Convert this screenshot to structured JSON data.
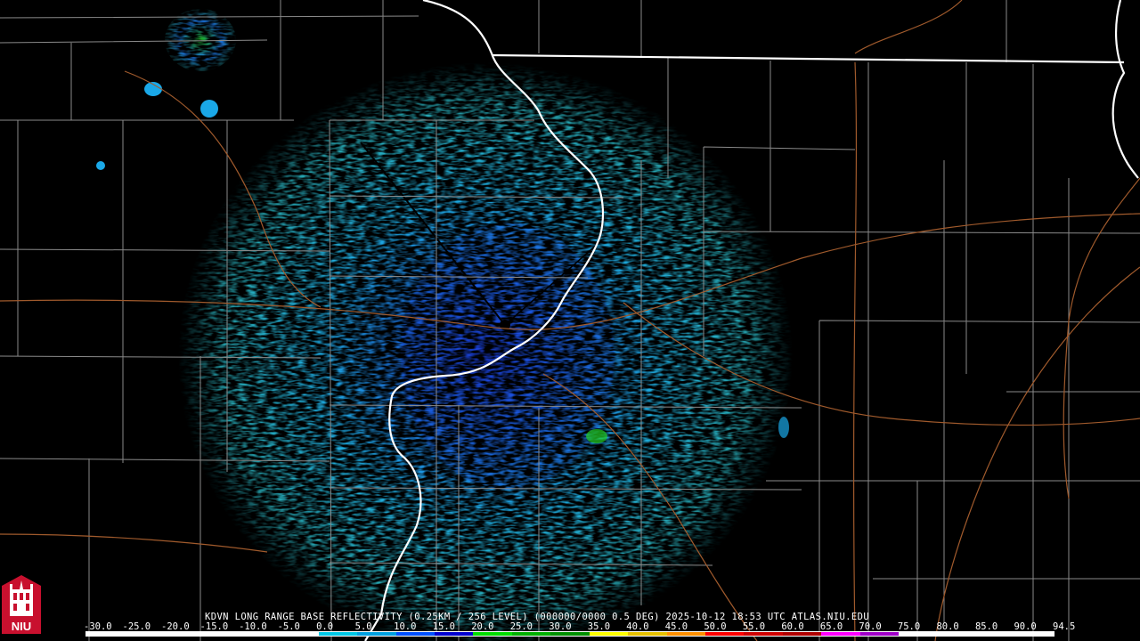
{
  "product": {
    "header": "KDVN LONG RANGE BASE REFLECTIVITY (0.25KM / 256 LEVEL) (000000/0000 0.5 DEG) 2025-10-12 18:53 UTC  ATLAS.NIU.EDU"
  },
  "scale": {
    "labels": [
      "-30.0",
      "-25.0",
      "-20.0",
      "-15.0",
      "-10.0",
      "-5.0",
      "0.0",
      "5.0",
      "10.0",
      "15.0",
      "20.0",
      "25.0",
      "30.0",
      "35.0",
      "40.0",
      "45.0",
      "50.0",
      "55.0",
      "60.0",
      "65.0",
      "70.0",
      "75.0",
      "80.0",
      "85.0",
      "90.0",
      "94.5"
    ],
    "colors": [
      "#ffffff",
      "#ffffff",
      "#ffffff",
      "#ffffff",
      "#ffffff",
      "#ffffff",
      "#00c8e6",
      "#00a0e0",
      "#0050ff",
      "#0000d0",
      "#00dd00",
      "#00b000",
      "#009000",
      "#ffff00",
      "#e6c000",
      "#ff9000",
      "#ff0000",
      "#d00000",
      "#b00000",
      "#ff00ff",
      "#a000c8",
      "#ffffff",
      "#ffffff",
      "#ffffff",
      "#ffffff"
    ]
  },
  "logo": {
    "text": "NIU",
    "colors": {
      "red": "#c8102e",
      "white": "#ffffff"
    }
  },
  "map": {
    "colors": {
      "background": "#000000",
      "state_border": "#ffffff",
      "county_line": "#8a8a8a",
      "highway": "#a05a2c",
      "echo_light": "#33e0f0",
      "echo_mid": "#1aa8e8",
      "echo_dark": "#1a3cd8",
      "echo_green": "#22cc22"
    },
    "radar_site": {
      "label": "KDVN"
    }
  }
}
